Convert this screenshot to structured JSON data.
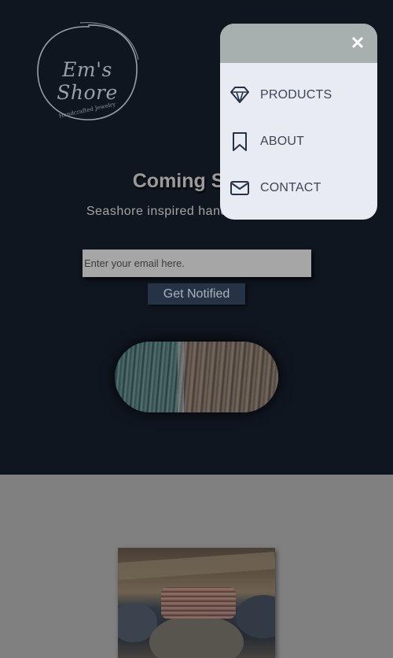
{
  "brand": {
    "logo_text": "Em's Shore",
    "tagline": "Handcrafted Jewelry"
  },
  "hero": {
    "title": "Coming Soon",
    "subtitle": "Seashore inspired handmade jewelry",
    "email_placeholder": "Enter your email here.",
    "notify_label": "Get Notified"
  },
  "menu": {
    "close_symbol": "✕",
    "items": [
      {
        "label": "PRODUCTS",
        "icon": "diamond-icon"
      },
      {
        "label": "ABOUT",
        "icon": "bookmark-icon"
      },
      {
        "label": "CONTACT",
        "icon": "envelope-icon"
      }
    ]
  },
  "colors": {
    "background": "#101620",
    "menu_header": "#a7b0ae",
    "menu_body": "#e8ebf2",
    "button": "#263346",
    "section2": "#808080"
  }
}
